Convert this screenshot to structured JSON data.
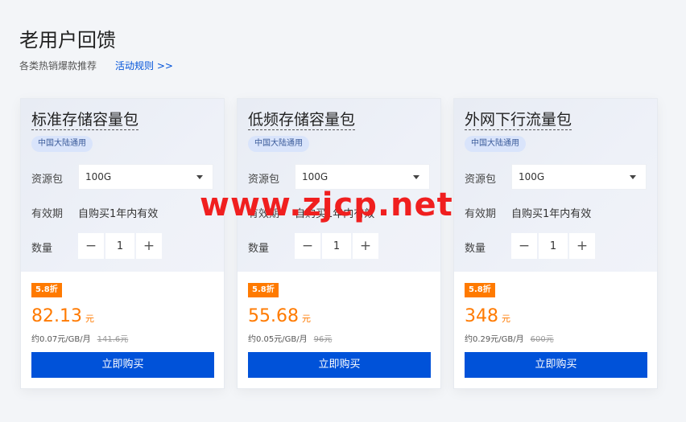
{
  "header": {
    "title": "老用户回馈",
    "subtitle": "各类热销爆款推荐",
    "rules_link": "活动规则 >>"
  },
  "labels": {
    "resource_package": "资源包",
    "validity": "有效期",
    "quantity": "数量",
    "buy_button": "立即购买"
  },
  "cards": [
    {
      "title": "标准存储容量包",
      "region": "中国大陆通用",
      "package": "100G",
      "validity": "自购买1年内有效",
      "quantity": "1",
      "discount": "5.8折",
      "price": "82.13",
      "price_unit": "元",
      "per_unit": "约0.07元/GB/月",
      "original_price": "141.6元"
    },
    {
      "title": "低频存储容量包",
      "region": "中国大陆通用",
      "package": "100G",
      "validity": "自购买1年内有效",
      "quantity": "1",
      "discount": "5.8折",
      "price": "55.68",
      "price_unit": "元",
      "per_unit": "约0.05元/GB/月",
      "original_price": "96元"
    },
    {
      "title": "外网下行流量包",
      "region": "中国大陆通用",
      "package": "100G",
      "validity": "自购买1年内有效",
      "quantity": "1",
      "discount": "5.8折",
      "price": "348",
      "price_unit": "元",
      "per_unit": "约0.29元/GB/月",
      "original_price": "600元"
    }
  ],
  "stepper": {
    "minus": "−",
    "plus": "+"
  },
  "watermark": "www.zjcp.net",
  "colors": {
    "accent_blue": "#0052d9",
    "discount_orange": "#ff7a00",
    "watermark_red": "#f01f1f"
  }
}
